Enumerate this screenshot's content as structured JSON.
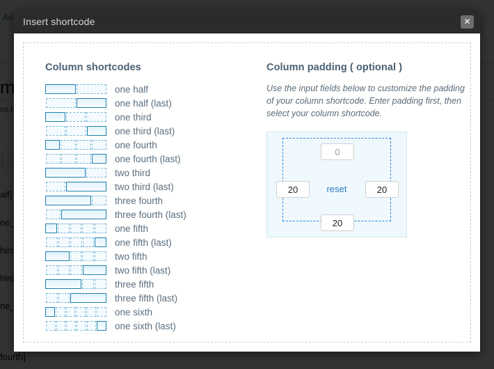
{
  "background": {
    "admin_bar_label": "Ad",
    "page_title_fragment": "m",
    "permalink_fragment": "ss.l",
    "editor_toolbar_quote": "“",
    "code_lines": [
      "alf]",
      "ne_",
      "hird]",
      "hird]",
      "ne_",
      "fourth]"
    ]
  },
  "modal": {
    "title": "Insert shortcode",
    "close_icon": "close-icon",
    "close_glyph": "✕"
  },
  "left_pane": {
    "heading": "Column shortcodes",
    "items": [
      {
        "label": "one half",
        "cells": 2,
        "solid_index": 0
      },
      {
        "label": "one half (last)",
        "cells": 2,
        "solid_index": 1
      },
      {
        "label": "one third",
        "cells": 3,
        "solid_index": 0
      },
      {
        "label": "one third (last)",
        "cells": 3,
        "solid_index": 2
      },
      {
        "label": "one fourth",
        "cells": 4,
        "solid_index": 0
      },
      {
        "label": "one fourth (last)",
        "cells": 4,
        "solid_index": 3
      },
      {
        "label": "two third",
        "cells": 3,
        "solid_index": 0,
        "solid_span": 2
      },
      {
        "label": "two third (last)",
        "cells": 3,
        "solid_index": 1,
        "solid_span": 2
      },
      {
        "label": "three fourth",
        "cells": 4,
        "solid_index": 0,
        "solid_span": 3
      },
      {
        "label": "three fourth (last)",
        "cells": 4,
        "solid_index": 1,
        "solid_span": 3
      },
      {
        "label": "one fifth",
        "cells": 5,
        "solid_index": 0
      },
      {
        "label": "one fifth (last)",
        "cells": 5,
        "solid_index": 4
      },
      {
        "label": "two fifth",
        "cells": 5,
        "solid_index": 0,
        "solid_span": 2
      },
      {
        "label": "two fifth (last)",
        "cells": 5,
        "solid_index": 3,
        "solid_span": 2
      },
      {
        "label": "three fifth",
        "cells": 5,
        "solid_index": 0,
        "solid_span": 3
      },
      {
        "label": "three fifth (last)",
        "cells": 5,
        "solid_index": 2,
        "solid_span": 3
      },
      {
        "label": "one sixth",
        "cells": 6,
        "solid_index": 0
      },
      {
        "label": "one sixth (last)",
        "cells": 6,
        "solid_index": 5
      }
    ]
  },
  "right_pane": {
    "heading": "Column padding ( optional )",
    "description": "Use the input fields below to customize the padding of your column shortcode. Enter padding first, then select your column shortcode.",
    "padding": {
      "top": "0",
      "left": "20",
      "right": "20",
      "bottom": "20",
      "reset_label": "reset"
    }
  },
  "colors": {
    "accent_blue": "#1f7fae",
    "link_blue": "#2a79c4",
    "titlebar": "#2b2b2b",
    "widget_bg": "#eff9fd"
  }
}
